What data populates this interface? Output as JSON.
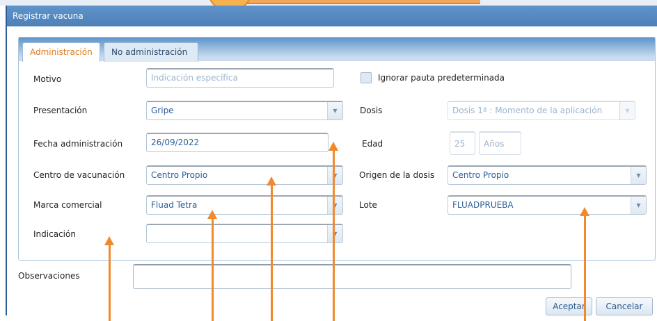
{
  "dialog": {
    "title": "Registrar vacuna"
  },
  "tabs": [
    {
      "label": "Administración",
      "active": true
    },
    {
      "label": "No administración",
      "active": false
    }
  ],
  "form": {
    "motivo": {
      "label": "Motivo",
      "placeholder": "Indicación específica"
    },
    "ignorar": {
      "label": "Ignorar pauta predeterminada",
      "checked": false
    },
    "presentacion": {
      "label": "Presentación",
      "value": "Gripe"
    },
    "dosis": {
      "label": "Dosis",
      "value": "Dosis 1ª : Momento de la aplicación"
    },
    "fecha": {
      "label": "Fecha administración",
      "value": "26/09/2022"
    },
    "edad": {
      "label": "Edad",
      "value": "25",
      "unit": "Años"
    },
    "centro": {
      "label": "Centro de vacunación",
      "value": "Centro Propio"
    },
    "origen": {
      "label": "Origen de la dosis",
      "value": "Centro Propio"
    },
    "marca": {
      "label": "Marca comercial",
      "value": "Fluad Tetra"
    },
    "lote": {
      "label": "Lote",
      "value": "FLUADPRUEBA"
    },
    "indicacion": {
      "label": "Indicación",
      "value": ""
    }
  },
  "observaciones": {
    "label": "Observaciones",
    "value": ""
  },
  "buttons": {
    "accept": "Aceptar",
    "cancel": "Cancelar"
  },
  "colors": {
    "title_bar": "#4d80b8",
    "active_tab_text": "#e07a1e",
    "annotation_arrow": "#f08a2c"
  }
}
